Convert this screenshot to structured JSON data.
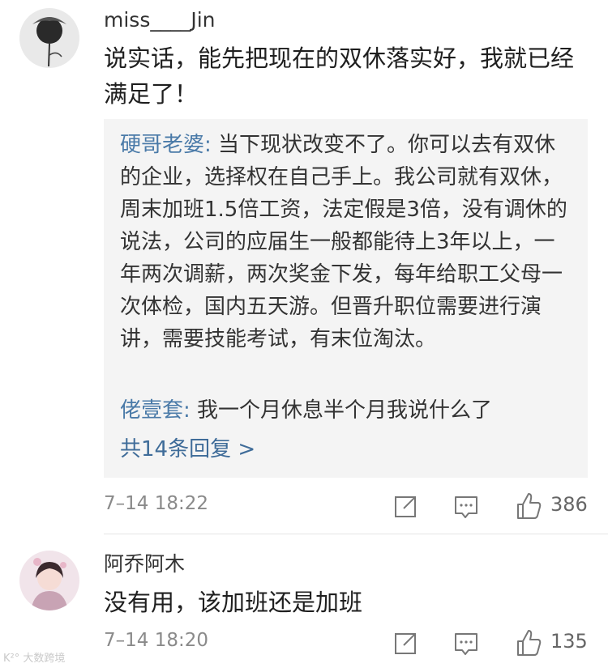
{
  "comments": [
    {
      "author": "miss____Jin",
      "text": "说实话，能先把现在的双休落实好，我就已经满足了！",
      "replies": [
        {
          "name": "硬哥老婆:",
          "text": " 当下现状改变不了。你可以去有双休的企业，选择权在自己手上。我公司就有双休，周末加班1.5倍工资，法定假是3倍，没有调休的说法，公司的应届生一般都能待上3年以上，一年两次调薪，两次奖金下发，每年给职工父母一次体检，国内五天游。但晋升职位需要进行演讲，需要技能考试，有末位淘汰。"
        },
        {
          "name": "佬壹套:",
          "text": " 我一个月休息半个月我说什么了"
        }
      ],
      "more_replies": "共14条回复 >",
      "time": "7–14 18:22",
      "likes": "386"
    },
    {
      "author": "阿乔阿木",
      "text": "没有用，该加班还是加班",
      "time": "7–14 18:20",
      "likes": "135"
    }
  ],
  "watermark": "K²° 大数跨境",
  "icons": {
    "share": "share-icon",
    "reply": "comment-icon",
    "like": "thumbs-up-icon"
  },
  "colors": {
    "link": "#3f6c99",
    "reply_bg": "#f4f4f4",
    "meta": "#8a8a8a"
  }
}
